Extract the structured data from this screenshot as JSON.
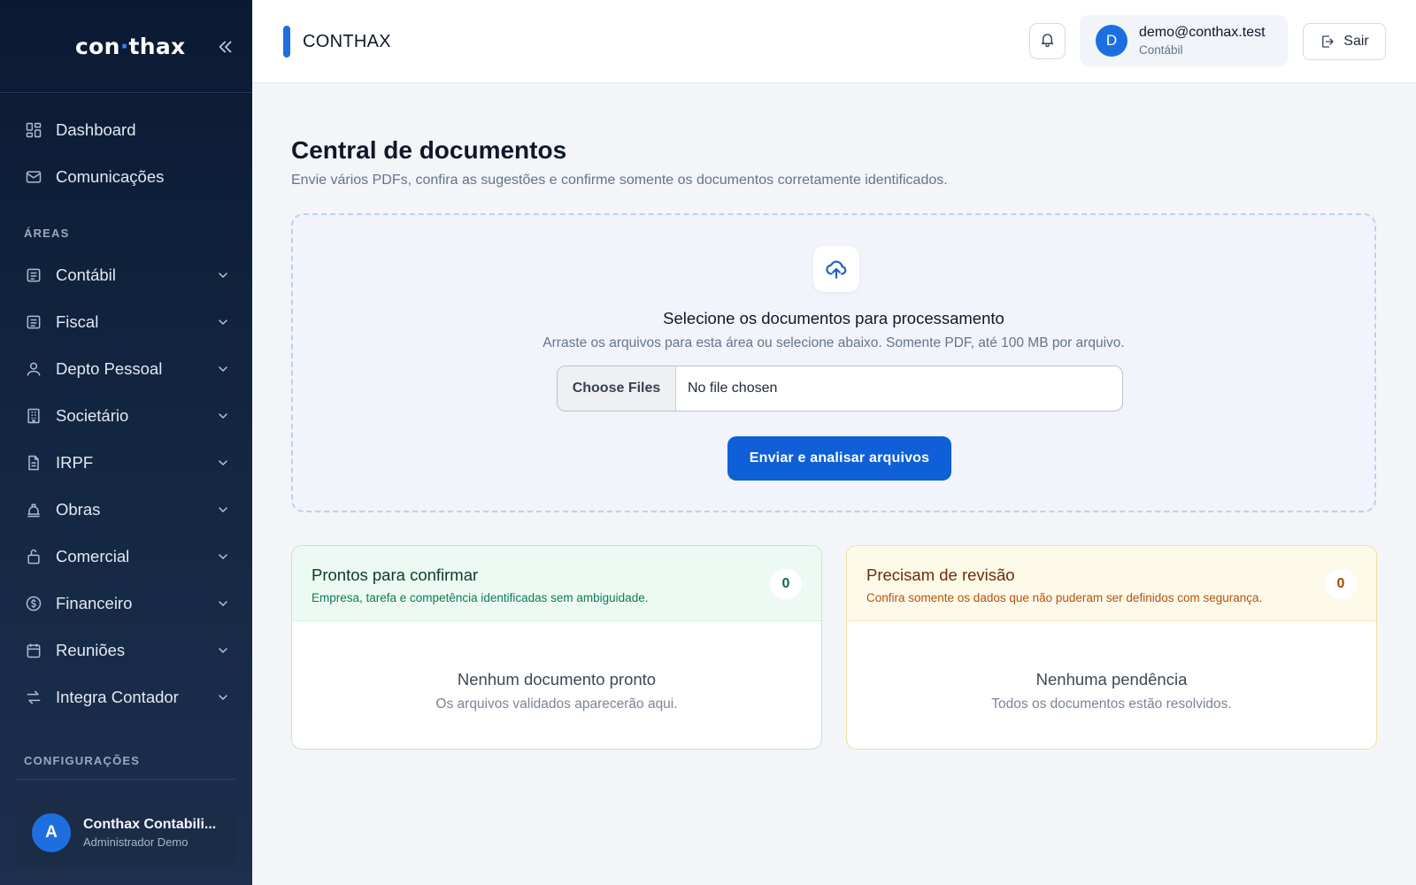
{
  "sidebar": {
    "logo_left": "con",
    "logo_dot": "·",
    "logo_right": "thax",
    "top_items": [
      {
        "label": "Dashboard",
        "icon": "grid-icon"
      },
      {
        "label": "Comunicações",
        "icon": "mail-icon"
      }
    ],
    "section_areas": "ÁREAS",
    "area_items": [
      {
        "label": "Contábil",
        "icon": "ledger-icon"
      },
      {
        "label": "Fiscal",
        "icon": "receipt-icon"
      },
      {
        "label": "Depto Pessoal",
        "icon": "user-icon"
      },
      {
        "label": "Societário",
        "icon": "building-icon"
      },
      {
        "label": "IRPF",
        "icon": "file-icon"
      },
      {
        "label": "Obras",
        "icon": "hardhat-icon"
      },
      {
        "label": "Comercial",
        "icon": "bag-icon"
      },
      {
        "label": "Financeiro",
        "icon": "coin-icon"
      },
      {
        "label": "Reuniões",
        "icon": "calendar-icon"
      },
      {
        "label": "Integra Contador",
        "icon": "swap-icon"
      }
    ],
    "section_config": "CONFIGURAÇÕES",
    "user": {
      "initial": "A",
      "name": "Conthax Contabili...",
      "role": "Administrador Demo"
    }
  },
  "topbar": {
    "title": "CONTHAX",
    "account": {
      "initial": "D",
      "email": "demo@conthax.test",
      "role": "Contábil"
    },
    "logout_label": "Sair"
  },
  "main": {
    "title": "Central de documentos",
    "subtitle": "Envie vários PDFs, confira as sugestões e confirme somente os documentos corretamente identificados.",
    "upload": {
      "title": "Selecione os documentos para processamento",
      "subtitle": "Arraste os arquivos para esta área ou selecione abaixo. Somente PDF, até 100 MB por arquivo.",
      "choose_label": "Choose Files",
      "file_status": "No file chosen",
      "submit_label": "Enviar e analisar arquivos"
    },
    "ready": {
      "title": "Prontos para confirmar",
      "subtitle": "Empresa, tarefa e competência identificadas sem ambiguidade.",
      "count": "0",
      "empty_title": "Nenhum documento pronto",
      "empty_subtitle": "Os arquivos validados aparecerão aqui."
    },
    "review": {
      "title": "Precisam de revisão",
      "subtitle": "Confira somente os dados que não puderam ser definidos com segurança.",
      "count": "0",
      "empty_title": "Nenhuma pendência",
      "empty_subtitle": "Todos os documentos estão resolvidos."
    }
  },
  "colors": {
    "accent": "#0f5fd8",
    "sidebar_bg": "#0b1a33",
    "ready_bg": "#ecfaf3",
    "review_bg": "#fefaea"
  }
}
